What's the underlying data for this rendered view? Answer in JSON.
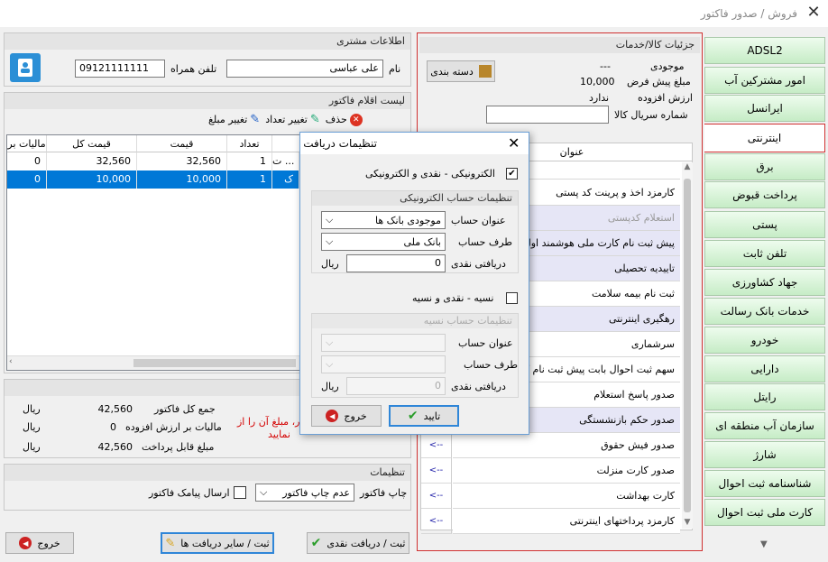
{
  "window": {
    "title": "فروش / صدور فاکتور",
    "close": "✕"
  },
  "customer": {
    "header": "اطلاعات مشتری",
    "name_label": "نام",
    "name_value": "علی عباسی",
    "phone_label": "تلفن همراه",
    "phone_value": "09121111111"
  },
  "invoice_items": {
    "header": "لیست اقلام فاکتور",
    "delete_label": "حذف",
    "change_qty_label": "تغییر تعداد",
    "change_amount_label": "تغییر مبلغ",
    "columns": [
      "مالیات بر",
      "قیمت کل",
      "قیمت",
      "تعداد"
    ],
    "rows": [
      {
        "tax": "0",
        "total": "32,560",
        "price": "32,560",
        "qty": "1",
        "name": "ت ..."
      },
      {
        "tax": "0",
        "total": "10,000",
        "price": "10,000",
        "qty": "1",
        "name": "ک"
      }
    ]
  },
  "totals": {
    "total_label": "جمع کل فاکتور",
    "total_value": "42,560",
    "vat_label": "مالیات بر ارزش افزوده",
    "vat_value": "0",
    "payable_label": "مبلغ قابل پرداخت",
    "payable_value": "42,560",
    "currency": "ریال",
    "warning_line1": "ور، مبلغ آن را از",
    "warning_line2": "نمایید"
  },
  "settings": {
    "header": "تنظیمات",
    "print_label": "چاپ فاکتور",
    "print_value": "عدم چاپ فاکتور",
    "sms_label": "ارسال پیامک فاکتور"
  },
  "bottom_buttons": {
    "exit": "خروج",
    "other_payment": "ثبت / سایر دریافت ها",
    "cash_payment": "ثبت / دریافت نقدی"
  },
  "product": {
    "header": "جزئیات کالا/خدمات",
    "category_btn": "دسته بندی",
    "stock_label": "موجودی",
    "stock_value": "---",
    "default_amount_label": "مبلغ پیش فرض",
    "default_amount_value": "10,000",
    "vat_label": "ارزش افزوده",
    "vat_value": "ندارد",
    "serial_label": "شماره سریال کالا",
    "list_header": "عنوان",
    "items": [
      "کارمزد اخذ و پرینت کد پستی",
      "استعلام کدپستی",
      "پیش ثبت نام کارت ملی هوشمند اول",
      "تاییدیه تحصیلی",
      "ثبت نام بیمه سلامت",
      "رهگیری اینترنتی",
      "سرشماری",
      "سهم ثبت احوال بابت پیش ثبت نام کا",
      "صدور پاسخ استعلام",
      "صدور حکم بازنشستگی",
      "صدور فیش حقوق",
      "صدور کارت منزلت",
      "کارت بهداشت",
      "کارمزد پرداختهای اینترنتی"
    ],
    "arrow": "<--"
  },
  "nav": {
    "items": [
      "ADSL2",
      "امور مشترکین آب",
      "ایرانسل",
      "اینترنتی",
      "برق",
      "پرداخت قبوض",
      "پستی",
      "تلفن ثابت",
      "جهاد کشاورزی",
      "خدمات بانک رسالت",
      "خودرو",
      "دارایی",
      "رایتل",
      "سازمان آب منطقه ای",
      "شارژ",
      "شناسنامه ثبت احوال",
      "کارت ملی ثبت احوال"
    ],
    "active": "اینترنتی"
  },
  "dialog": {
    "title": "تنظیمات دریافت",
    "electronic_check_label": "الکترونیکی - نقدی و الکترونیکی",
    "electronic_group": "تنظیمات حساب الکترونیکی",
    "account_title_label": "عنوان حساب",
    "account_title_value": "موجودی بانک ها",
    "account_side_label": "طرف حساب",
    "account_side_value": "بانک ملی",
    "cash_received_label": "دریافتی نقدی",
    "cash_received_value": "0",
    "currency": "ریال",
    "credit_check_label": "نسیه - نقدی و نسیه",
    "credit_group": "تنظیمات حساب نسیه",
    "credit_title_label": "عنوان حساب",
    "credit_side_label": "طرف حساب",
    "credit_cash_label": "دریافتی نقدی",
    "credit_cash_value": "0",
    "confirm": "تایید",
    "exit": "خروج"
  },
  "colors": {
    "accent": "#0078d7",
    "highlight_border": "#d03030",
    "nav_green": "#c6ecc6"
  }
}
